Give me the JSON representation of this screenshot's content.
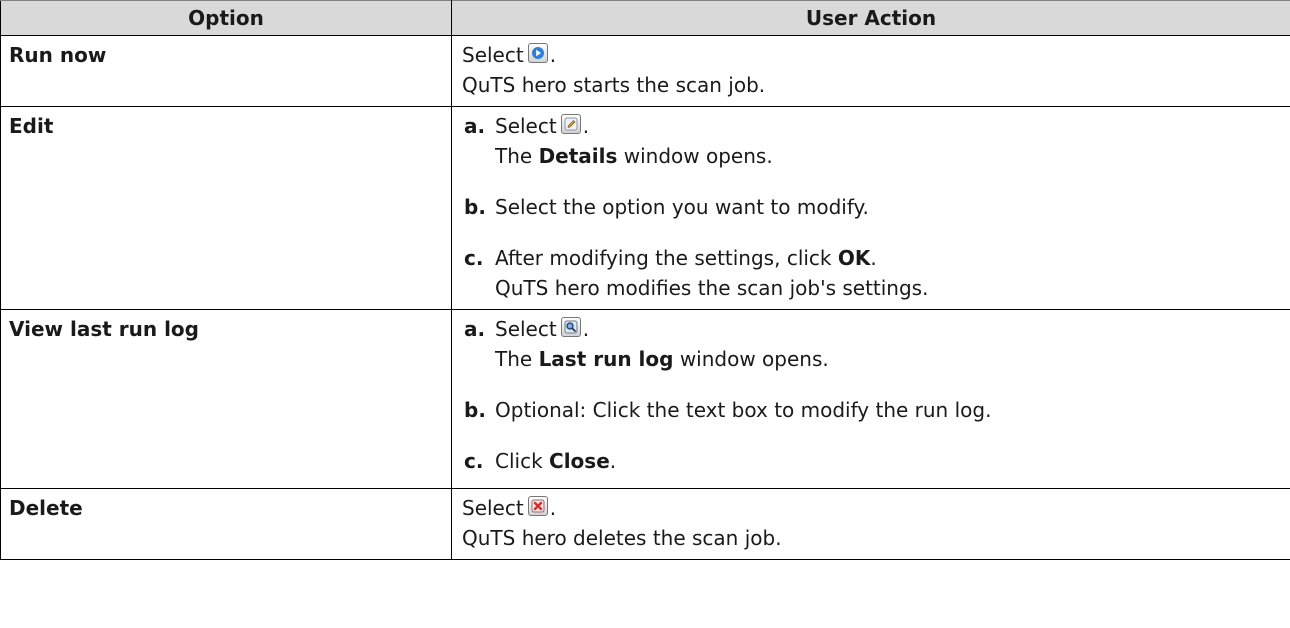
{
  "table": {
    "headers": [
      "Option",
      "User Action"
    ],
    "run_now": {
      "label": "Run now",
      "select": "Select",
      "period": ".",
      "result": "QuTS hero starts the scan job."
    },
    "edit": {
      "label": "Edit",
      "a_letter": "a.",
      "a_select": "Select",
      "a_period": ".",
      "a_line2_pre": "The",
      "a_line2_bold": "Details",
      "a_line2_post": "window opens.",
      "b_letter": "b.",
      "b_text": "Select the option you want to modify.",
      "c_letter": "c.",
      "c_pre": "After modifying the settings, click",
      "c_bold": "OK",
      "c_post": ".",
      "c_line2": "QuTS hero modifies the scan job's settings."
    },
    "view_log": {
      "label": "View last run log",
      "a_letter": "a.",
      "a_select": "Select",
      "a_period": ".",
      "a_line2_pre": "The",
      "a_line2_bold": "Last run log",
      "a_line2_post": "window opens.",
      "b_letter": "b.",
      "b_text": "Optional: Click the text box to modify the run log.",
      "c_letter": "c.",
      "c_pre": "Click",
      "c_bold": "Close",
      "c_post": "."
    },
    "delete": {
      "label": "Delete",
      "select": "Select",
      "period": ".",
      "result": "QuTS hero deletes the scan job."
    }
  },
  "icons": {
    "run_now": "play-icon",
    "edit": "edit-pencil-icon",
    "view_log": "magnifier-icon",
    "delete": "delete-x-icon"
  },
  "colors": {
    "header_bg": "#d9d9d9",
    "play_blue": "#2f7fd6",
    "delete_red": "#d92b2b"
  }
}
